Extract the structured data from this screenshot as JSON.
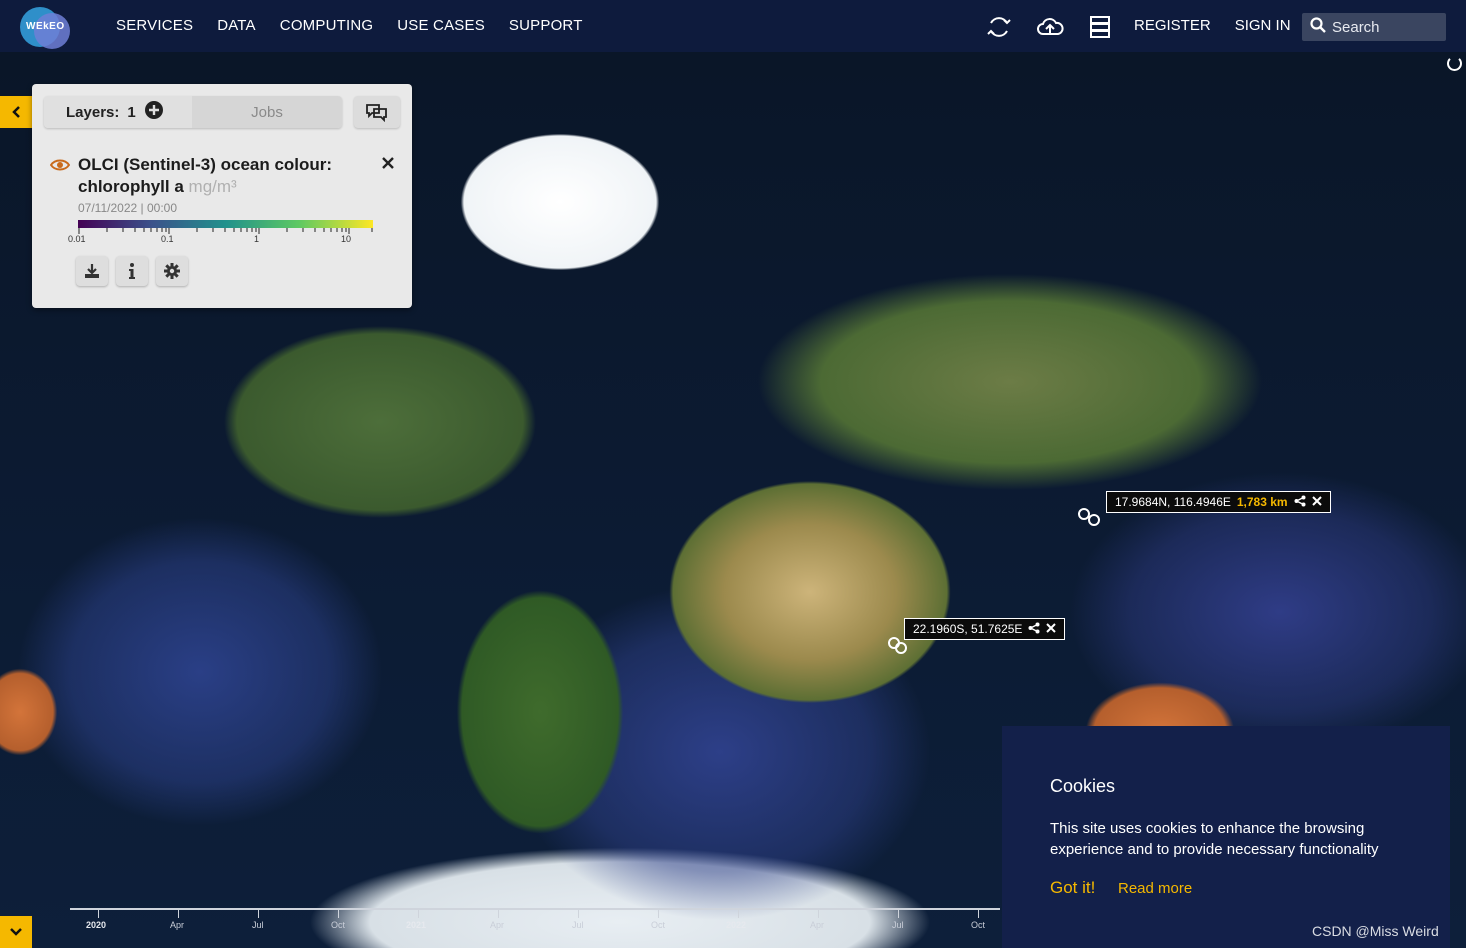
{
  "app": {
    "brand": "WEkEO",
    "accent": "#f5b800"
  },
  "nav": {
    "menu": [
      "SERVICES",
      "DATA",
      "COMPUTING",
      "USE CASES",
      "SUPPORT"
    ],
    "register": "REGISTER",
    "sign_in": "SIGN IN",
    "search_placeholder": "Search",
    "icons": [
      "sync-icon",
      "cloud-upload-icon",
      "server-icon"
    ]
  },
  "panel": {
    "layers_label": "Layers:",
    "layers_count": "1",
    "jobs_label": "Jobs",
    "layer": {
      "title": "OLCI (Sentinel-3) ocean colour: chlorophyll a",
      "unit": "mg/m³",
      "date": "07/11/2022",
      "time": "00:00",
      "colorbar_labels": [
        "0.01",
        "0.1",
        "1",
        "10"
      ]
    }
  },
  "tooltips": [
    {
      "coords": "17.9684N, 116.4946E",
      "distance": "1,783 km"
    },
    {
      "coords": "22.1960S, 51.7625E",
      "distance": ""
    }
  ],
  "cookie": {
    "title": "Cookies",
    "text": "This site uses cookies to enhance the browsing experience and to provide necessary functionality",
    "accept": "Got it!",
    "read_more": "Read more"
  },
  "timeline": {
    "labels": [
      "2020",
      "Apr",
      "Jul",
      "Oct",
      "2021",
      "Apr",
      "Jul",
      "Oct",
      "2022",
      "Apr",
      "Jul",
      "Oct"
    ]
  },
  "watermark": "CSDN @Miss Weird"
}
